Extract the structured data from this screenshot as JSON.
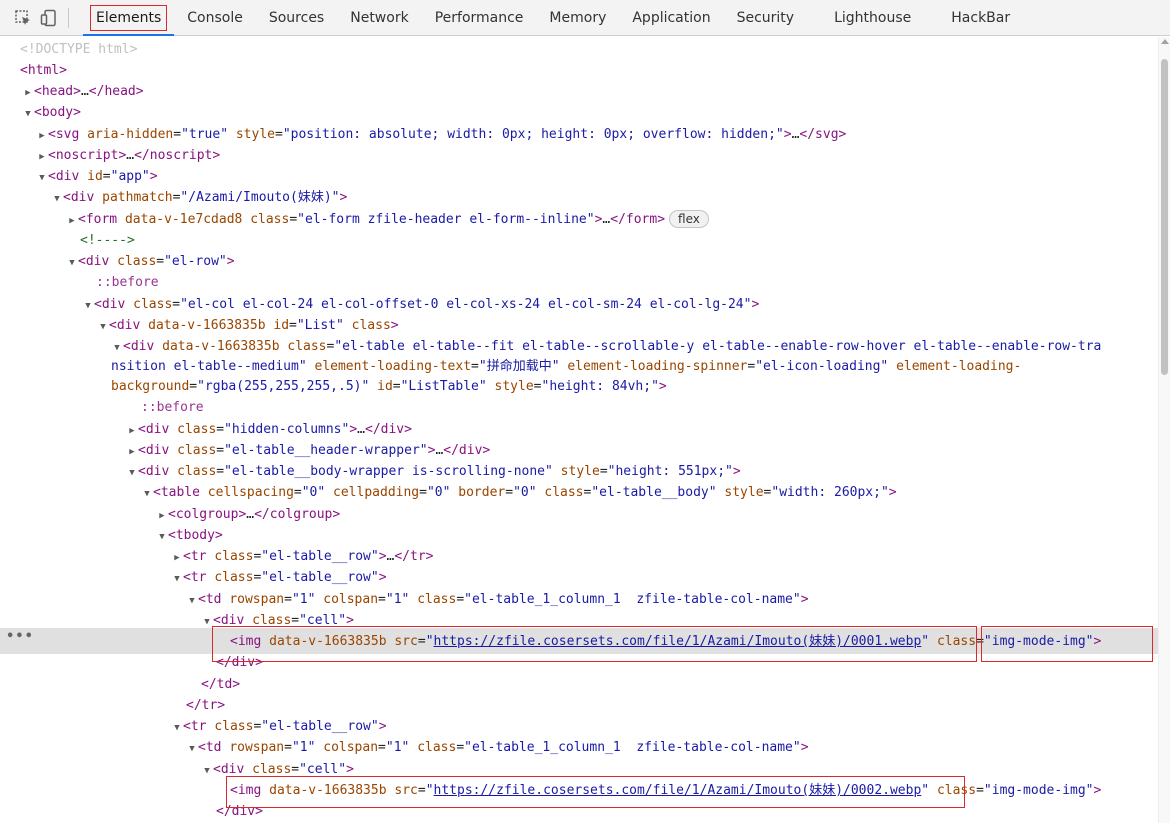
{
  "toolbar": {
    "tabs": [
      {
        "label": "Elements",
        "active": true
      },
      {
        "label": "Console"
      },
      {
        "label": "Sources"
      },
      {
        "label": "Network"
      },
      {
        "label": "Performance"
      },
      {
        "label": "Memory"
      },
      {
        "label": "Application"
      },
      {
        "label": "Security"
      },
      {
        "label": "Lighthouse"
      },
      {
        "label": "HackBar"
      }
    ],
    "icons": [
      "inspect-element-icon",
      "device-toolbar-icon"
    ]
  },
  "accent_colors": {
    "active_tab": "#1a73e8",
    "highlight_box": "#d9292b",
    "selected_row": "#e0e0e0"
  },
  "dom_tree": {
    "l0": {
      "doctype": "<!DOCTYPE html>"
    },
    "l1": {
      "open": "<html>"
    },
    "l2": {
      "open": "<head>",
      "ellipsis": "…",
      "close": "</head>"
    },
    "l3": {
      "open": "<body>"
    },
    "l4": {
      "tag": "<svg",
      "a1": "aria-hidden",
      "v1": "\"true\"",
      "a2": "style",
      "v2": "\"position: absolute; width: 0px; height: 0px; overflow: hidden;\"",
      "end": ">",
      "ellipsis": "…",
      "close": "</svg>"
    },
    "l5": {
      "open": "<noscript>",
      "ellipsis": "…",
      "close": "</noscript>"
    },
    "l6": {
      "tag": "<div",
      "a1": "id",
      "v1": "\"app\"",
      "end": ">"
    },
    "l7": {
      "tag": "<div",
      "a1": "pathmatch",
      "v1": "\"/Azami/Imouto(妹妹)\"",
      "end": ">"
    },
    "l8": {
      "tag": "<form",
      "a1": "data-v-1e7cdad8",
      "a2": "class",
      "v2": "\"el-form zfile-header el-form--inline\"",
      "end": ">",
      "ellipsis": "…",
      "close": "</form>",
      "badge": "flex"
    },
    "l9": {
      "comment": "<!---->"
    },
    "l10": {
      "tag": "<div",
      "a1": "class",
      "v1": "\"el-row\"",
      "end": ">"
    },
    "l11": {
      "pseudo": "::before"
    },
    "l12": {
      "tag": "<div",
      "a1": "class",
      "v1": "\"el-col el-col-24 el-col-offset-0 el-col-xs-24 el-col-sm-24 el-col-lg-24\"",
      "end": ">"
    },
    "l13": {
      "tag": "<div",
      "a1": "data-v-1663835b",
      "a2": "id",
      "v2": "\"List\"",
      "a3": "class",
      "end": ">"
    },
    "l14a": {
      "tag": "<div",
      "a1": "data-v-1663835b",
      "a2": "class",
      "v2": "\"el-table el-table--fit el-table--scrollable-y el-table--enable-row-hover el-table--enable-row-tra"
    },
    "l14b": {
      "v2b": "nsition el-table--medium\"",
      "a3": "element-loading-text",
      "v3": "\"拼命加载中\"",
      "a4": "element-loading-spinner",
      "v4": "\"el-icon-loading\"",
      "a5": "element-loading-"
    },
    "l14c": {
      "a5b": "background",
      "v5": "\"rgba(255,255,255,.5)\"",
      "a6": "id",
      "v6": "\"ListTable\"",
      "a7": "style",
      "v7": "\"height: 84vh;\"",
      "end": ">"
    },
    "l15": {
      "pseudo": "::before"
    },
    "l16": {
      "tag": "<div",
      "a1": "class",
      "v1": "\"hidden-columns\"",
      "end": ">",
      "ellipsis": "…",
      "close": "</div>"
    },
    "l17": {
      "tag": "<div",
      "a1": "class",
      "v1": "\"el-table__header-wrapper\"",
      "end": ">",
      "ellipsis": "…",
      "close": "</div>"
    },
    "l18": {
      "tag": "<div",
      "a1": "class",
      "v1": "\"el-table__body-wrapper is-scrolling-none\"",
      "a2": "style",
      "v2": "\"height: 551px;\"",
      "end": ">"
    },
    "l19": {
      "tag": "<table",
      "a1": "cellspacing",
      "v1": "\"0\"",
      "a2": "cellpadding",
      "v2": "\"0\"",
      "a3": "border",
      "v3": "\"0\"",
      "a4": "class",
      "v4": "\"el-table__body\"",
      "a5": "style",
      "v5": "\"width: 260px;\"",
      "end": ">"
    },
    "l20": {
      "open": "<colgroup>",
      "ellipsis": "…",
      "close": "</colgroup>"
    },
    "l21": {
      "open": "<tbody>"
    },
    "l22": {
      "tag": "<tr",
      "a1": "class",
      "v1": "\"el-table__row\"",
      "end": ">",
      "ellipsis": "…",
      "close": "</tr>"
    },
    "l23": {
      "tag": "<tr",
      "a1": "class",
      "v1": "\"el-table__row\"",
      "end": ">"
    },
    "l24": {
      "tag": "<td",
      "a1": "rowspan",
      "v1": "\"1\"",
      "a2": "colspan",
      "v2": "\"1\"",
      "a3": "class",
      "v3": "\"el-table_1_column_1  zfile-table-col-name\"",
      "end": ">"
    },
    "l25": {
      "tag": "<div",
      "a1": "class",
      "v1": "\"cell\"",
      "end": ">"
    },
    "l26": {
      "tag": "<img",
      "a1": "data-v-1663835b",
      "a2": "src",
      "q": "\"",
      "url": "https://zfile.cosersets.com/file/1/Azami/Imouto(妹妹)/0001.webp",
      "a3": "class",
      "v3": "\"img-mode-img\"",
      "end": ">"
    },
    "l27": {
      "close": "</div>"
    },
    "l28": {
      "close": "</td>"
    },
    "l29": {
      "close": "</tr>"
    },
    "l30": {
      "tag": "<tr",
      "a1": "class",
      "v1": "\"el-table__row\"",
      "end": ">"
    },
    "l31": {
      "tag": "<td",
      "a1": "rowspan",
      "v1": "\"1\"",
      "a2": "colspan",
      "v2": "\"1\"",
      "a3": "class",
      "v3": "\"el-table_1_column_1  zfile-table-col-name\"",
      "end": ">"
    },
    "l32": {
      "tag": "<div",
      "a1": "class",
      "v1": "\"cell\"",
      "end": ">"
    },
    "l33": {
      "tag": "<img",
      "a1": "data-v-1663835b",
      "a2": "src",
      "q": "\"",
      "url": "https://zfile.cosersets.com/file/1/Azami/Imouto(妹妹)/0002.webp",
      "a3": "class",
      "v3": "\"img-mode-img\"",
      "end": ">"
    },
    "l34": {
      "close": "</div>"
    }
  },
  "selected_row_marker": "…"
}
